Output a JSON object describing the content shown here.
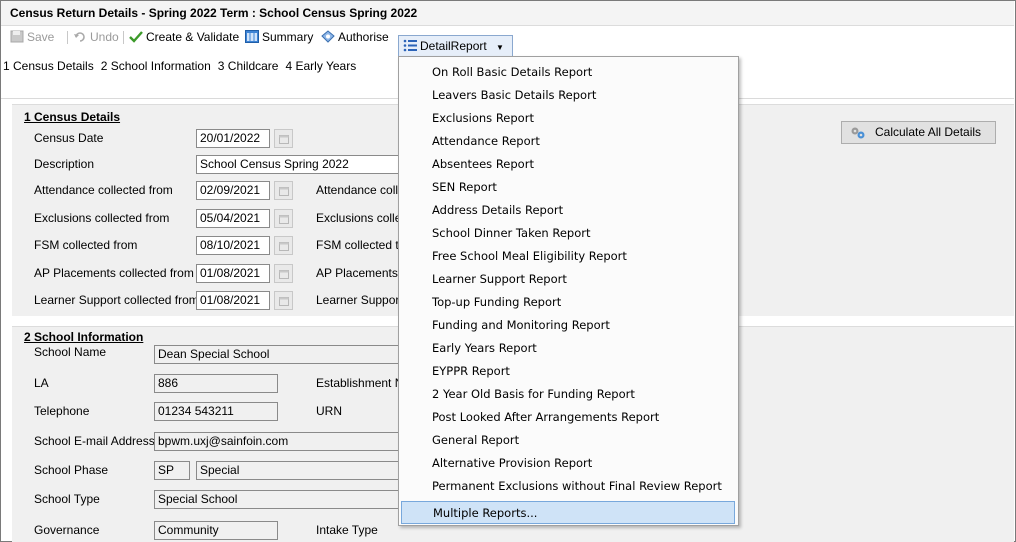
{
  "window": {
    "title": "Census Return Details - Spring 2022 Term : School Census Spring 2022"
  },
  "toolbar": {
    "save": "Save",
    "undo": "Undo",
    "create_validate": "Create & Validate",
    "summary": "Summary",
    "authorise": "Authorise",
    "detail_report": "DetailReport"
  },
  "nav_links": [
    "1 Census Details",
    "2 School Information",
    "3 Childcare",
    "4 Early Years"
  ],
  "census_details": {
    "title": "1 Census Details",
    "census_date_label": "Census Date",
    "census_date": "20/01/2022",
    "description_label": "Description",
    "description": "School Census Spring 2022",
    "attendance_from_label": "Attendance collected from",
    "attendance_from": "02/09/2021",
    "attendance_to_label": "Attendance colle",
    "exclusions_from_label": "Exclusions collected from",
    "exclusions_from": "05/04/2021",
    "exclusions_to_label": "Exclusions colle",
    "fsm_from_label": "FSM collected from",
    "fsm_from": "08/10/2021",
    "fsm_to_label": "FSM collected to",
    "ap_from_label": "AP Placements collected from",
    "ap_from": "01/08/2021",
    "ap_to_label": "AP Placements c",
    "ls_from_label": "Learner Support collected from",
    "ls_from": "01/08/2021",
    "ls_to_label": "Learner Support"
  },
  "calculate_all": "Calculate All Details",
  "school_info": {
    "title": "2 School Information",
    "school_name_label": "School Name",
    "school_name": "Dean Special School",
    "la_label": "LA",
    "la": "886",
    "establishment_label": "Establishment N",
    "telephone_label": "Telephone",
    "telephone": "01234 543211",
    "urn_label": "URN",
    "email_label": "School E-mail Address",
    "email": "bpwm.uxj@sainfoin.com",
    "phase_label": "School Phase",
    "phase_code": "SP",
    "phase_name": "Special",
    "type_label": "School Type",
    "type": "Special School",
    "governance_label": "Governance",
    "governance": "Community",
    "intake_label": "Intake Type"
  },
  "menu": {
    "items": [
      "On Roll Basic Details Report",
      "Leavers Basic Details Report",
      "Exclusions Report",
      "Attendance Report",
      "Absentees Report",
      "SEN Report",
      "Address Details Report",
      "School Dinner Taken Report",
      "Free School Meal Eligibility Report",
      "Learner Support Report",
      "Top-up Funding Report",
      "Funding and Monitoring Report",
      "Early Years Report",
      "EYPPR Report",
      "2 Year Old Basis for Funding Report",
      "Post Looked After Arrangements Report",
      "General Report",
      "Alternative Provision Report",
      "Permanent Exclusions without Final Review Report",
      "Multiple Reports..."
    ],
    "highlighted_index": 19
  },
  "colors": {
    "menu_highlight": "#cfe3f7",
    "panel": "#f0f0f0"
  }
}
